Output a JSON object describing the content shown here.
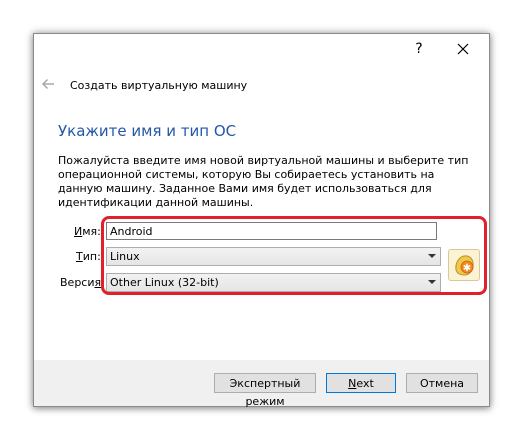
{
  "window": {
    "help_label": "?",
    "close_icon": "close-icon"
  },
  "nav": {
    "back_icon": "back-arrow-icon",
    "title": "Создать виртуальную машину"
  },
  "heading": "Укажите имя и тип ОС",
  "description": "Пожалуйста введите имя новой виртуальной машины и выберите тип операционной системы, которую Вы собираетесь установить на данную машину. Заданное Вами имя будет использоваться для идентификации данной машины.",
  "form": {
    "name": {
      "label_mn": "И",
      "label_rest": "мя:",
      "value": "Android"
    },
    "type": {
      "label_mn": "Т",
      "label_rest": "ип:",
      "value": "Linux"
    },
    "version": {
      "label_pre": "Верси",
      "label_mn": "я",
      "label_rest": ":",
      "value": "Other Linux (32-bit)"
    },
    "os_icon": "linux-os-icon"
  },
  "buttons": {
    "expert_label": "Экспертный режим",
    "next_mn": "N",
    "next_rest": "ext",
    "cancel_label": "Отмена"
  },
  "colors": {
    "heading": "#2457a8",
    "highlight": "#e0202a",
    "button_bar": "#f0f0f0"
  }
}
